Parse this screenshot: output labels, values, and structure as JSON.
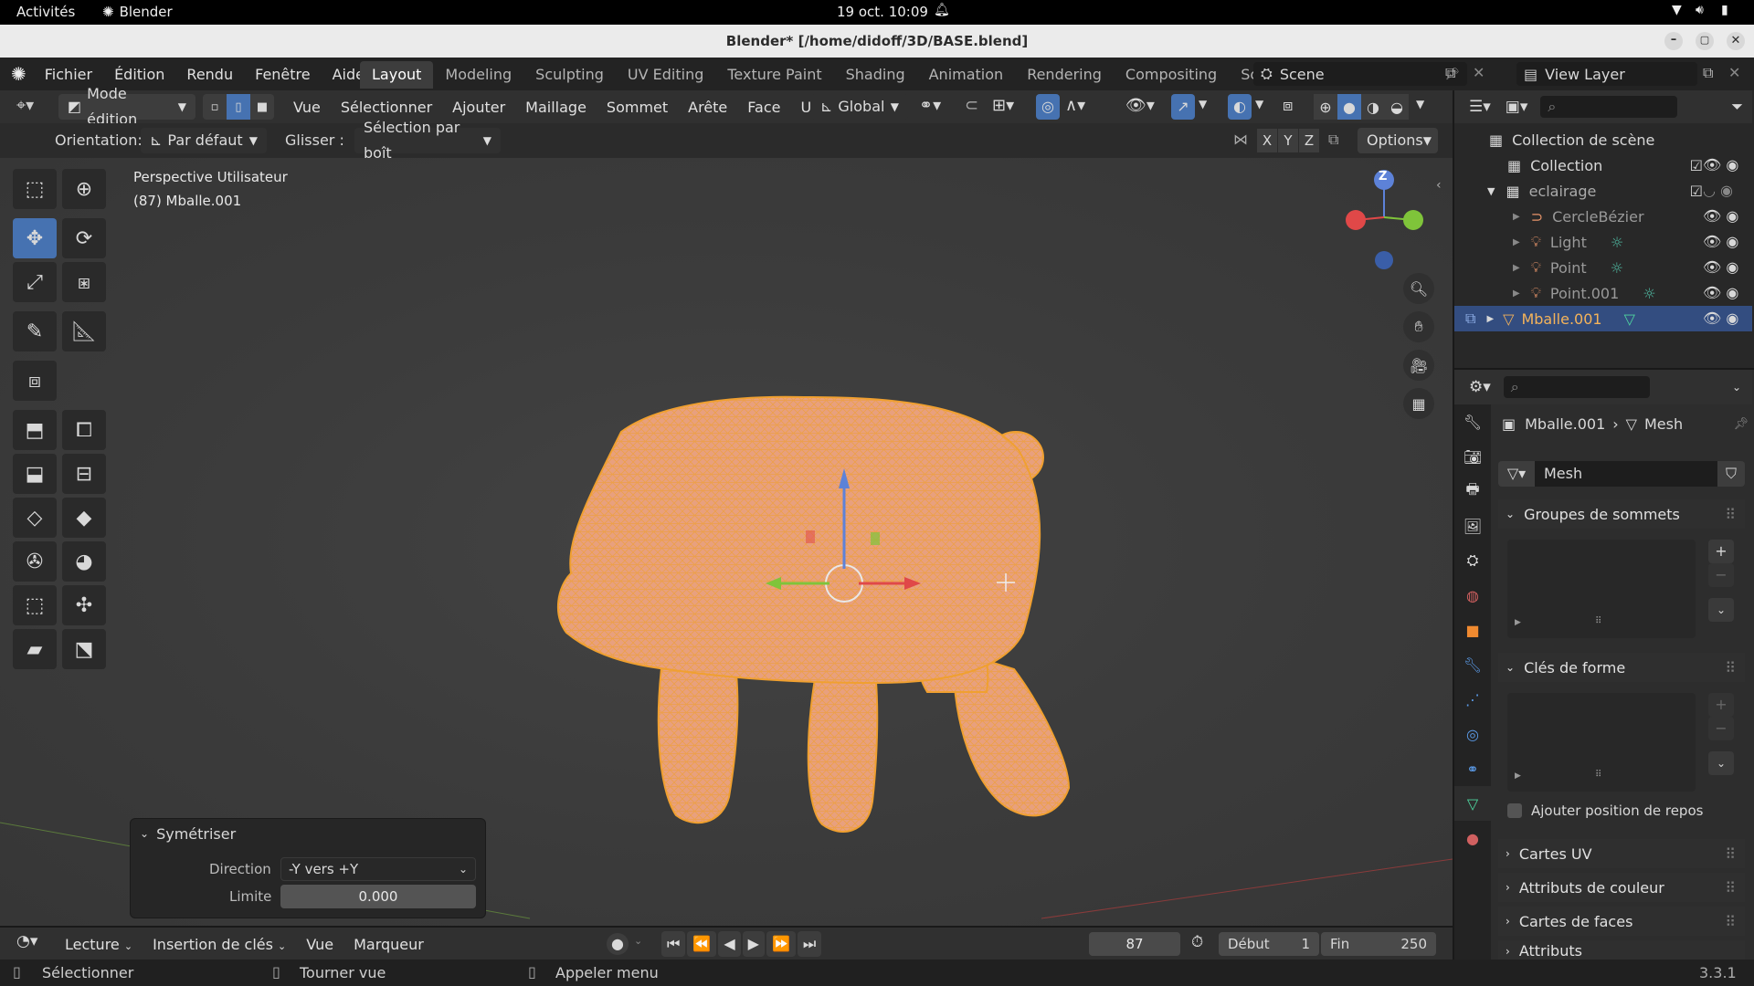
{
  "system": {
    "activities": "Activités",
    "app_name": "Blender",
    "datetime": "19 oct.  10:09"
  },
  "window": {
    "title": "Blender* [/home/didoff/3D/BASE.blend]"
  },
  "menus": [
    "Fichier",
    "Édition",
    "Rendu",
    "Fenêtre",
    "Aide"
  ],
  "workspaces": [
    "Layout",
    "Modeling",
    "Sculpting",
    "UV Editing",
    "Texture Paint",
    "Shading",
    "Animation",
    "Rendering",
    "Compositing",
    "Scriptin"
  ],
  "active_workspace": "Layout",
  "scene": {
    "name": "Scene",
    "view_layer": "View Layer"
  },
  "viewport_header": {
    "mode": "Mode édition",
    "menus": [
      "Vue",
      "Sélectionner",
      "Ajouter",
      "Maillage",
      "Sommet",
      "Arête",
      "Face",
      "UV"
    ],
    "transform": "Global"
  },
  "tool_settings": {
    "orientation_label": "Orientation:",
    "orientation_value": "Par défaut",
    "drag_label": "Glisser :",
    "drag_value": "Sélection par boît",
    "axes": [
      "X",
      "Y",
      "Z"
    ],
    "options": "Options"
  },
  "viewport": {
    "view_name": "Perspective Utilisateur",
    "object_info": "(87) Mballe.001",
    "gizmo_z": "Z"
  },
  "outliner": {
    "root": "Collection de scène",
    "items": [
      {
        "label": "Collection",
        "indent": 0
      },
      {
        "label": "eclairage",
        "indent": 0
      },
      {
        "label": "CercleBézier",
        "indent": 1
      },
      {
        "label": "Light",
        "indent": 1
      },
      {
        "label": "Point",
        "indent": 1
      },
      {
        "label": "Point.001",
        "indent": 1
      },
      {
        "label": "Mballe.001",
        "indent": 0,
        "selected": true
      }
    ]
  },
  "properties": {
    "breadcrumb_object": "Mballe.001",
    "breadcrumb_data": "Mesh",
    "mesh_name": "Mesh",
    "panels": {
      "vertex_groups": "Groupes de sommets",
      "shape_keys": "Clés de forme",
      "add_rest": "Ajouter position de repos",
      "uv_maps": "Cartes UV",
      "color_attrs": "Attributs de couleur",
      "face_maps": "Cartes de faces",
      "attributes": "Attributs"
    }
  },
  "redo_panel": {
    "title": "Symétriser",
    "direction_label": "Direction",
    "direction_value": "-Y vers +Y",
    "limit_label": "Limite",
    "limit_value": "0.000"
  },
  "timeline": {
    "menus": [
      "Lecture",
      "Insertion de clés",
      "Vue",
      "Marqueur"
    ],
    "current_frame": "87",
    "start_label": "Début",
    "start_value": "1",
    "end_label": "Fin",
    "end_value": "250"
  },
  "statusbar": {
    "select": "Sélectionner",
    "rotate": "Tourner vue",
    "menu": "Appeler menu",
    "version": "3.3.1"
  },
  "colors": {
    "accent": "#4672b1",
    "mesh": "#e8a07e",
    "wire": "#f0a030",
    "selected_text": "#f4b35a"
  }
}
